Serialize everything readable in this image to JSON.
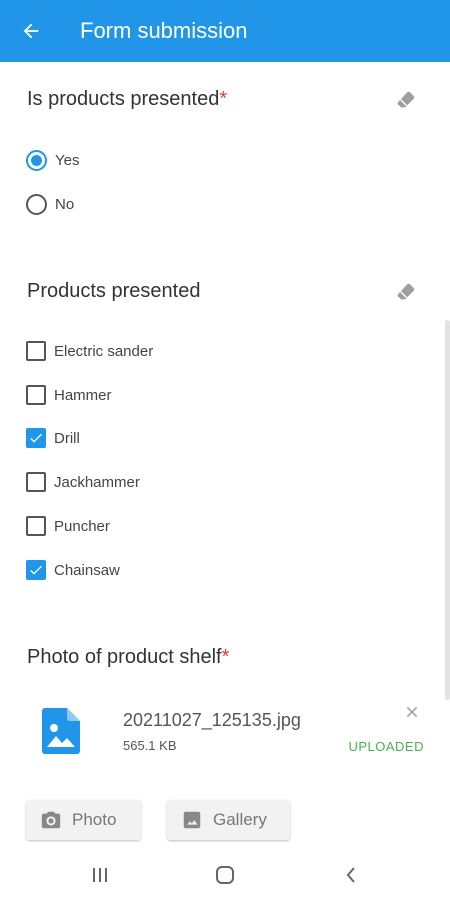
{
  "appbar": {
    "title": "Form submission",
    "back_icon": "arrow-left-icon"
  },
  "colors": {
    "accent": "#2196e8",
    "required": "#e53935",
    "uploaded": "#4caf50"
  },
  "question1": {
    "title": "Is products presented",
    "required_mark": "*",
    "options": [
      {
        "label": "Yes",
        "selected": true
      },
      {
        "label": "No",
        "selected": false
      }
    ]
  },
  "question2": {
    "title": "Products presented",
    "options": [
      {
        "label": "Electric sander",
        "checked": false
      },
      {
        "label": "Hammer",
        "checked": false
      },
      {
        "label": "Drill",
        "checked": true
      },
      {
        "label": "Jackhammer",
        "checked": false
      },
      {
        "label": "Puncher",
        "checked": false
      },
      {
        "label": "Chainsaw",
        "checked": true
      }
    ]
  },
  "question3": {
    "title": "Photo of product shelf",
    "required_mark": "*",
    "file": {
      "name": "20211027_125135.jpg",
      "size": "565.1 KB",
      "status": "UPLOADED"
    },
    "buttons": {
      "photo": "Photo",
      "gallery": "Gallery"
    }
  }
}
